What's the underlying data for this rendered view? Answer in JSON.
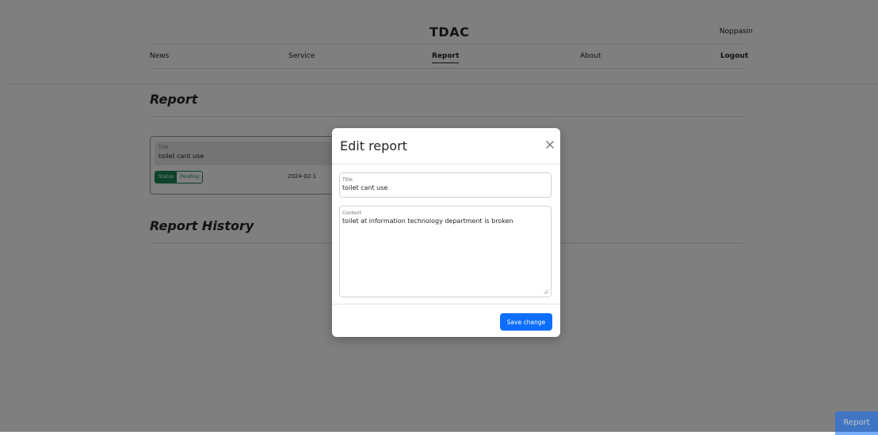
{
  "navbar": {
    "brand": "TDAC",
    "username": "Noppasin",
    "items": [
      {
        "label": "News"
      },
      {
        "label": "Service"
      },
      {
        "label": "Report"
      },
      {
        "label": "About"
      },
      {
        "label": "Logout"
      }
    ],
    "active_item": "Report"
  },
  "report_section": {
    "title": "Report",
    "card": {
      "title_label": "Title",
      "title_value": "toilet cant use",
      "status_label": "Status",
      "status_value": "Pending",
      "date": "2024-02-1"
    }
  },
  "history_section": {
    "title": "Report History"
  },
  "modal": {
    "title": "Edit report",
    "close_icon": "close-icon",
    "title_field": {
      "label": "Title",
      "value": "toilet cant use"
    },
    "content_field": {
      "label": "Content",
      "value": "toilet at information technology department is broken"
    },
    "save_label": "Save change"
  },
  "floating_button": {
    "label": "Report"
  },
  "colors": {
    "primary": "#0d6efd",
    "success": "#198754",
    "backdrop": "rgba(0,0,0,0.5)"
  }
}
